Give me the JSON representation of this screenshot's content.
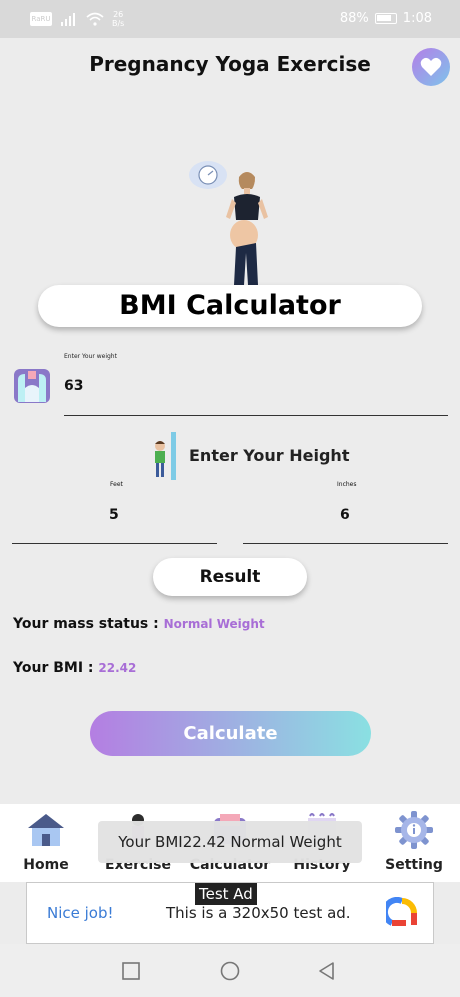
{
  "status_bar": {
    "left_box": "RaRU",
    "speed_top": "26",
    "speed_bottom": "B/s",
    "battery_percent": "88%",
    "time": "1:08"
  },
  "header": {
    "title": "Pregnancy Yoga Exercise",
    "heart_icon": "heart-icon"
  },
  "calculator": {
    "title": "BMI Calculator",
    "weight_label": "Enter Your weight",
    "weight_value": "63",
    "height_title": "Enter Your Height",
    "feet_label": "Feet",
    "feet_value": "5",
    "inches_label": "Inches",
    "inches_value": "6",
    "result_label": "Result",
    "mass_status_label": "Your mass status :",
    "mass_status_value": "Normal Weight",
    "bmi_label": "Your BMI :",
    "bmi_value": "22.42",
    "calculate_label": "Calculate"
  },
  "bottom_nav": {
    "items": [
      {
        "label": "Home",
        "icon": "home-icon"
      },
      {
        "label": "Exercise",
        "icon": "exercise-icon"
      },
      {
        "label": "Calculator",
        "icon": "calculator-icon"
      },
      {
        "label": "History",
        "icon": "history-icon"
      },
      {
        "label": "Setting",
        "icon": "gear-icon"
      }
    ]
  },
  "toast": {
    "text": "Your BMI22.42 Normal Weight"
  },
  "ad": {
    "badge": "Test Ad",
    "cta": "Nice job!",
    "text": "This is a 320x50 test ad."
  },
  "colors": {
    "accent_purple": "#a86ed6",
    "gradient_start": "#b47ee2",
    "gradient_end": "#8ae0e2"
  }
}
